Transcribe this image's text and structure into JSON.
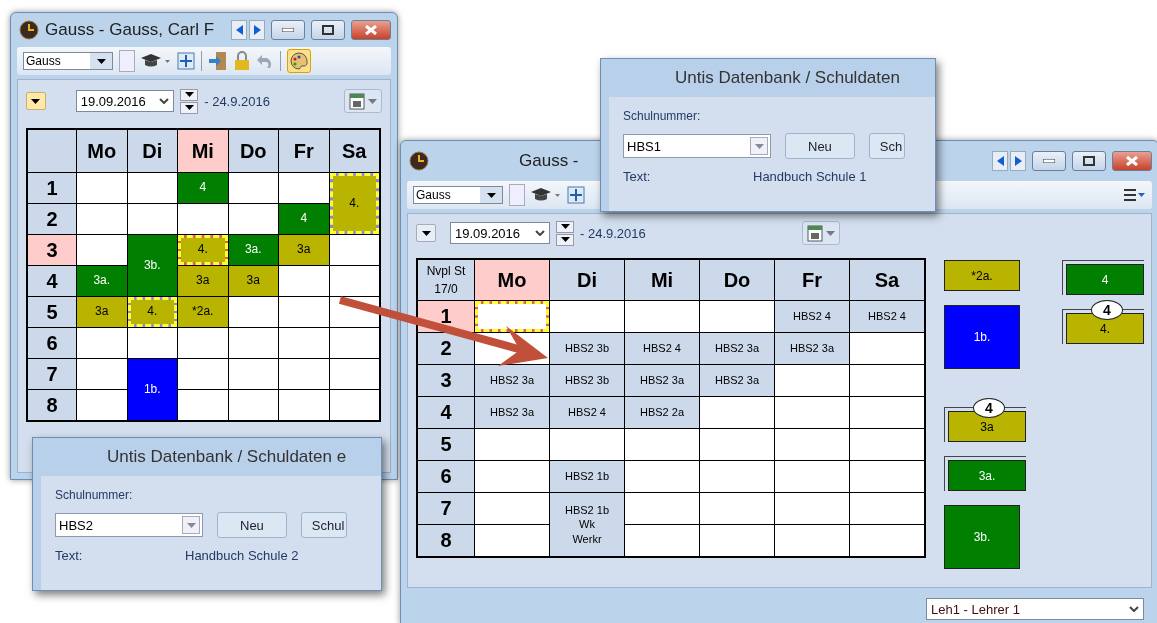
{
  "left_window": {
    "title": "Gauss - Gauss, Carl F",
    "toolbar": {
      "element": "Gauss"
    },
    "date": {
      "from": "19.09.2016",
      "to": "- 24.9.2016"
    },
    "timetable": {
      "days": [
        {
          "label": "Mo",
          "selected": false
        },
        {
          "label": "Di",
          "selected": false
        },
        {
          "label": "Mi",
          "selected": true
        },
        {
          "label": "Do",
          "selected": false
        },
        {
          "label": "Fr",
          "selected": false
        },
        {
          "label": "Sa",
          "selected": false
        }
      ],
      "rows": [
        {
          "label": "1",
          "selected": false,
          "cells": [
            {
              "kind": "empty"
            },
            {
              "kind": "empty"
            },
            {
              "kind": "lesson",
              "lines": [
                "4"
              ],
              "color": "#007f00",
              "double": false,
              "marked": false,
              "selected": false
            },
            {
              "kind": "empty"
            },
            {
              "kind": "empty"
            },
            {
              "kind": "lesson",
              "lines": [
                "4."
              ],
              "color": "#b8b400",
              "double": true,
              "marked": true,
              "selected": false
            }
          ]
        },
        {
          "label": "2",
          "selected": false,
          "cells": [
            {
              "kind": "empty"
            },
            {
              "kind": "empty"
            },
            {
              "kind": "empty"
            },
            {
              "kind": "empty"
            },
            {
              "kind": "lesson",
              "lines": [
                "4"
              ],
              "color": "#007f00",
              "double": false,
              "marked": false,
              "selected": false
            },
            ""
          ]
        },
        {
          "label": "3",
          "selected": true,
          "cells": [
            {
              "kind": "empty"
            },
            {
              "kind": "lesson",
              "lines": [
                "3b."
              ],
              "color": "#007f00",
              "double": true,
              "marked": false,
              "selected": false
            },
            {
              "kind": "lesson",
              "lines": [
                "4."
              ],
              "color": "#b8b400",
              "double": false,
              "marked": true,
              "selected": true
            },
            {
              "kind": "lesson",
              "lines": [
                "3a."
              ],
              "color": "#007f00",
              "double": false,
              "marked": false,
              "selected": false
            },
            {
              "kind": "lesson",
              "lines": [
                "3a"
              ],
              "color": "#b8b400",
              "double": false,
              "marked": false,
              "selected": false
            },
            {
              "kind": "empty"
            }
          ]
        },
        {
          "label": "4",
          "selected": false,
          "cells": [
            {
              "kind": "lesson",
              "lines": [
                "3a."
              ],
              "color": "#007f00",
              "double": false,
              "marked": false,
              "selected": false
            },
            "",
            {
              "kind": "lesson",
              "lines": [
                "3a"
              ],
              "color": "#b8b400",
              "double": false,
              "marked": false,
              "selected": false
            },
            {
              "kind": "lesson",
              "lines": [
                "3a"
              ],
              "color": "#b8b400",
              "double": false,
              "marked": false,
              "selected": false
            },
            {
              "kind": "empty"
            },
            {
              "kind": "empty"
            }
          ]
        },
        {
          "label": "5",
          "selected": false,
          "cells": [
            {
              "kind": "lesson",
              "lines": [
                "3a"
              ],
              "color": "#b8b400",
              "double": false,
              "marked": false,
              "selected": false
            },
            {
              "kind": "lesson",
              "lines": [
                "4."
              ],
              "color": "#b8b400",
              "double": false,
              "marked": true,
              "selected": false
            },
            {
              "kind": "lesson",
              "lines": [
                "*2a."
              ],
              "color": "#b8b400",
              "double": false,
              "marked": false,
              "selected": false
            },
            {
              "kind": "empty"
            },
            {
              "kind": "empty"
            },
            {
              "kind": "empty"
            }
          ]
        },
        {
          "label": "6",
          "selected": false,
          "cells": [
            {
              "kind": "empty"
            },
            {
              "kind": "empty"
            },
            {
              "kind": "empty"
            },
            {
              "kind": "empty"
            },
            {
              "kind": "empty"
            },
            {
              "kind": "empty"
            }
          ]
        },
        {
          "label": "7",
          "selected": false,
          "cells": [
            {
              "kind": "empty"
            },
            {
              "kind": "lesson",
              "lines": [
                "1b."
              ],
              "color": "#0000ff",
              "double": true,
              "marked": false,
              "selected": false
            },
            {
              "kind": "empty"
            },
            {
              "kind": "empty"
            },
            {
              "kind": "empty"
            },
            {
              "kind": "empty"
            }
          ]
        },
        {
          "label": "8",
          "selected": false,
          "cells": [
            {
              "kind": "empty"
            },
            "",
            {
              "kind": "empty"
            },
            {
              "kind": "empty"
            },
            {
              "kind": "empty"
            },
            {
              "kind": "empty"
            }
          ]
        }
      ]
    }
  },
  "left_dialog": {
    "title": "Untis Datenbank / Schuldaten e",
    "group": "Schulnummer:",
    "school": "HBS2",
    "buttons": [
      "Neu",
      "Schul"
    ],
    "text_label": "Text:",
    "text_value": "Handbuch Schule 2"
  },
  "right_window": {
    "title": "Gauss -",
    "toolbar": {
      "element": "Gauss"
    },
    "date": {
      "from": "19.09.2016",
      "to": "- 24.9.2016"
    },
    "timetable": {
      "corner": [
        "Nvpl St",
        "17/0"
      ],
      "days": [
        {
          "label": "Mo",
          "selected": true
        },
        {
          "label": "Di",
          "selected": false
        },
        {
          "label": "Mi",
          "selected": false
        },
        {
          "label": "Do",
          "selected": false
        },
        {
          "label": "Fr",
          "selected": false
        },
        {
          "label": "Sa",
          "selected": false
        }
      ],
      "rows": [
        {
          "label": "1",
          "selected": true,
          "cells": [
            {
              "kind": "lesson",
              "color": "#ffffff",
              "double": false,
              "marked": true,
              "selected": true
            },
            {
              "kind": "empty"
            },
            {
              "kind": "empty"
            },
            {
              "kind": "empty"
            },
            {
              "kind": "lesson",
              "lines": [
                "HBS2 4"
              ],
              "color": "#ccd9ea",
              "double": false,
              "marked": false,
              "selected": false
            },
            {
              "kind": "lesson",
              "lines": [
                "HBS2 4"
              ],
              "color": "#ccd9ea",
              "double": false,
              "marked": false,
              "selected": false
            }
          ]
        },
        {
          "label": "2",
          "selected": false,
          "cells": [
            {
              "kind": "empty"
            },
            {
              "kind": "lesson",
              "lines": [
                "HBS2 3b"
              ],
              "color": "#ccd9ea",
              "double": false,
              "marked": false,
              "selected": false
            },
            {
              "kind": "lesson",
              "lines": [
                "HBS2 4"
              ],
              "color": "#ccd9ea",
              "double": false,
              "marked": false,
              "selected": false
            },
            {
              "kind": "lesson",
              "lines": [
                "HBS2 3a"
              ],
              "color": "#ccd9ea",
              "double": false,
              "marked": false,
              "selected": false
            },
            {
              "kind": "lesson",
              "lines": [
                "HBS2 3a"
              ],
              "color": "#ccd9ea",
              "double": false,
              "marked": false,
              "selected": false
            },
            {
              "kind": "empty"
            }
          ]
        },
        {
          "label": "3",
          "selected": false,
          "cells": [
            {
              "kind": "lesson",
              "lines": [
                "HBS2 3a"
              ],
              "color": "#ccd9ea",
              "double": false,
              "marked": false,
              "selected": false
            },
            {
              "kind": "lesson",
              "lines": [
                "HBS2 3b"
              ],
              "color": "#ccd9ea",
              "double": false,
              "marked": false,
              "selected": false
            },
            {
              "kind": "lesson",
              "lines": [
                "HBS2 3a"
              ],
              "color": "#ccd9ea",
              "double": false,
              "marked": false,
              "selected": false
            },
            {
              "kind": "lesson",
              "lines": [
                "HBS2 3a"
              ],
              "color": "#ccd9ea",
              "double": false,
              "marked": false,
              "selected": false
            },
            {
              "kind": "empty"
            },
            {
              "kind": "empty"
            }
          ]
        },
        {
          "label": "4",
          "selected": false,
          "cells": [
            {
              "kind": "lesson",
              "lines": [
                "HBS2 3a"
              ],
              "color": "#ccd9ea",
              "double": false,
              "marked": false,
              "selected": false
            },
            {
              "kind": "lesson",
              "lines": [
                "HBS2 4"
              ],
              "color": "#ccd9ea",
              "double": false,
              "marked": false,
              "selected": false
            },
            {
              "kind": "lesson",
              "lines": [
                "HBS2 2a"
              ],
              "color": "#ccd9ea",
              "double": false,
              "marked": false,
              "selected": false
            },
            {
              "kind": "empty"
            },
            {
              "kind": "empty"
            },
            {
              "kind": "empty"
            }
          ]
        },
        {
          "label": "5",
          "selected": false,
          "cells": [
            {
              "kind": "empty"
            },
            {
              "kind": "empty"
            },
            {
              "kind": "empty"
            },
            {
              "kind": "empty"
            },
            {
              "kind": "empty"
            },
            {
              "kind": "empty"
            }
          ]
        },
        {
          "label": "6",
          "selected": false,
          "cells": [
            {
              "kind": "empty"
            },
            {
              "kind": "lesson",
              "lines": [
                "HBS2 1b"
              ],
              "color": "#ccd9ea",
              "double": false,
              "marked": false,
              "selected": false
            },
            {
              "kind": "empty"
            },
            {
              "kind": "empty"
            },
            {
              "kind": "empty"
            },
            {
              "kind": "empty"
            }
          ]
        },
        {
          "label": "7",
          "selected": false,
          "cells": [
            {
              "kind": "empty"
            },
            {
              "kind": "lesson",
              "lines": [
                "HBS2 1b",
                "Wk",
                "Werkr"
              ],
              "color": "#ccd9ea",
              "double": true,
              "marked": false,
              "selected": false
            },
            {
              "kind": "empty"
            },
            {
              "kind": "empty"
            },
            {
              "kind": "empty"
            },
            {
              "kind": "empty"
            }
          ]
        },
        {
          "label": "8",
          "selected": false,
          "cells": [
            {
              "kind": "empty"
            },
            "",
            {
              "kind": "empty"
            },
            {
              "kind": "empty"
            },
            {
              "kind": "empty"
            },
            {
              "kind": "empty"
            }
          ]
        }
      ]
    },
    "unscheduled": {
      "columns": [
        [
          {
            "label": "*2a.",
            "color": "#b8b400",
            "kind": "single"
          },
          {
            "label": "1b.",
            "color": "#0000ff",
            "kind": "tall"
          },
          {
            "label": "3a",
            "color": "#b8b400",
            "kind": "stacked",
            "badge": "4"
          },
          {
            "label": "3a.",
            "color": "#007f00",
            "kind": "stacked"
          },
          {
            "label": "3b.",
            "color": "#007f00",
            "kind": "tall"
          }
        ],
        [
          {
            "label": "4",
            "color": "#007f00",
            "kind": "stacked"
          },
          {
            "label": "4.",
            "color": "#b8b400",
            "kind": "stacked",
            "badge": "4"
          }
        ]
      ]
    },
    "status_bar": {
      "teacher": "Leh1 - Lehrer 1"
    }
  },
  "right_dialog": {
    "title": "Untis Datenbank / Schuldaten",
    "group": "Schulnummer:",
    "school": "HBS1",
    "buttons": [
      "Neu",
      "Sch"
    ],
    "text_label": "Text:",
    "text_value": "Handbuch Schule 1"
  }
}
